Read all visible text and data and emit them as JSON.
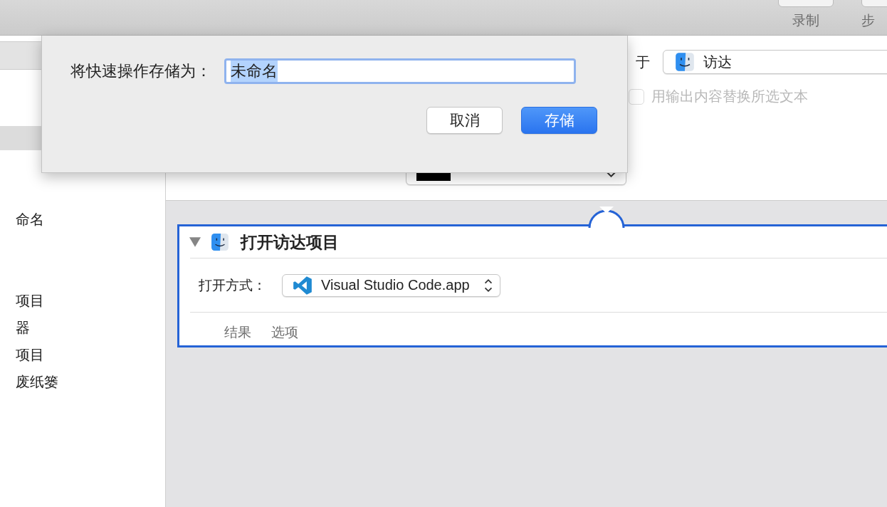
{
  "toolbar": {
    "buttons": [
      {
        "label": "录制"
      },
      {
        "label": "步"
      }
    ]
  },
  "sidebar": {
    "items": [
      {
        "label": "命名"
      },
      {
        "label": "项目"
      },
      {
        "label": "器"
      },
      {
        "label": "项目"
      },
      {
        "label": "废纸篓"
      }
    ]
  },
  "workflow": {
    "location_label": "于",
    "location_value": "访达",
    "replace_checkbox": {
      "label": "用输出内容替换所选文本",
      "checked": false,
      "disabled": true
    }
  },
  "action": {
    "title": "打开访达项目",
    "expanded": true,
    "open_with_label": "打开方式：",
    "app": "Visual Studio Code.app",
    "tabs": [
      {
        "label": "结果"
      },
      {
        "label": "选项"
      }
    ]
  },
  "dialog": {
    "label": "将快速操作存储为：",
    "value": "未命名",
    "buttons": [
      {
        "label": "取消",
        "kind": "cancel"
      },
      {
        "label": "存储",
        "kind": "default"
      }
    ]
  }
}
